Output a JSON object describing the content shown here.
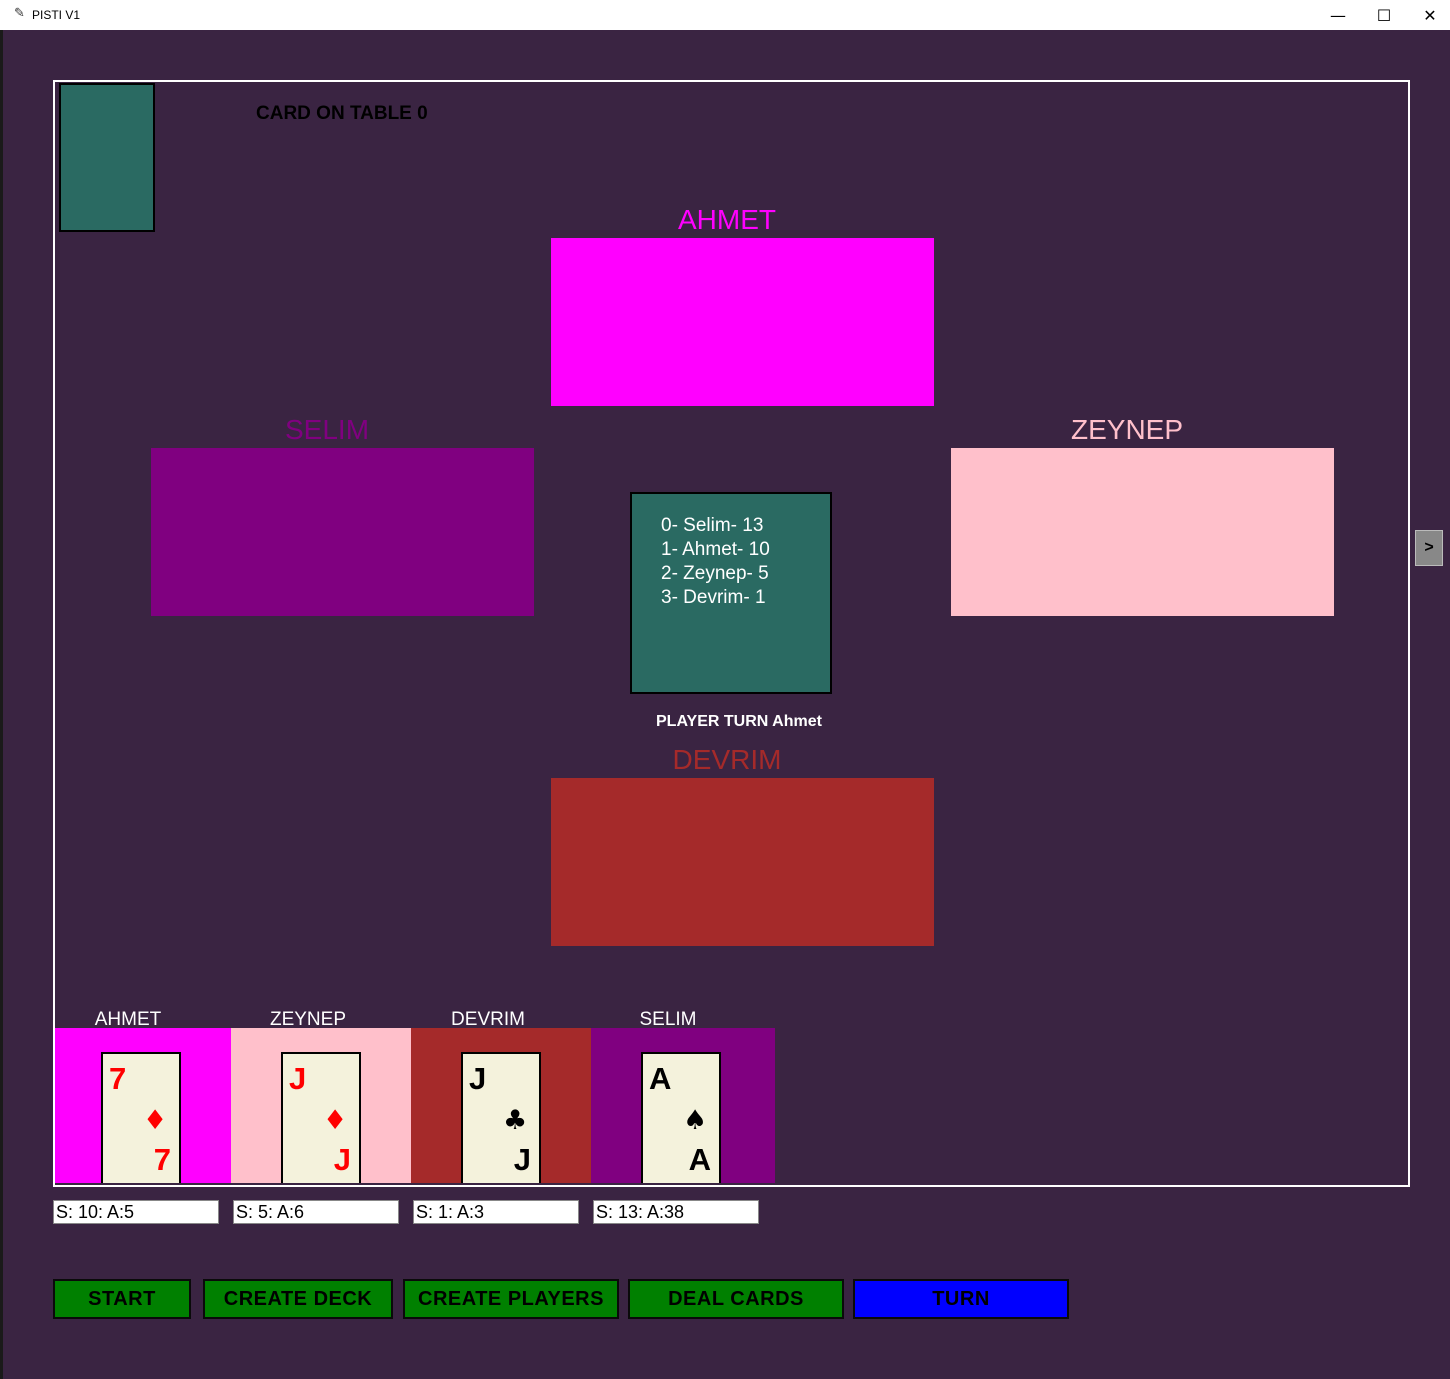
{
  "window": {
    "title": "PISTI V1",
    "icons": [
      "feather-icon",
      "minimize-icon",
      "maximize-icon",
      "close-icon"
    ],
    "controls": {
      "minimize": "—",
      "maximize": "☐",
      "close": "✕"
    }
  },
  "table": {
    "card_on_table_label": "CARD ON TABLE 0",
    "players": [
      {
        "name": "AHMET",
        "color": "#ff00ff"
      },
      {
        "name": "SELIM",
        "color": "#800080"
      },
      {
        "name": "ZEYNEP",
        "color": "#ffc0cb"
      },
      {
        "name": "DEVRIM",
        "color": "#a52a2a"
      }
    ],
    "scoreboard": [
      "0- Selim- 13",
      "1- Ahmet- 10",
      "2- Zeynep- 5",
      "3- Devrim- 1"
    ],
    "player_turn": "PLAYER TURN Ahmet",
    "scroll_button": ">"
  },
  "hands": [
    {
      "name": "AHMET",
      "bg": "#ff00ff",
      "card": {
        "rank": "7",
        "suit": "♦",
        "suit_color": "#ff0000"
      },
      "score": "S: 10: A:5"
    },
    {
      "name": "ZEYNEP",
      "bg": "#ffc0cb",
      "card": {
        "rank": "J",
        "suit": "♦",
        "suit_color": "#ff0000"
      },
      "score": "S: 5: A:6"
    },
    {
      "name": "DEVRIM",
      "bg": "#a52a2a",
      "card": {
        "rank": "J",
        "suit": "♣",
        "suit_color": "#000000"
      },
      "score": "S: 1: A:3"
    },
    {
      "name": "SELIM",
      "bg": "#800080",
      "card": {
        "rank": "A",
        "suit": "♠",
        "suit_color": "#000000"
      },
      "score": "S: 13: A:38"
    }
  ],
  "buttons": [
    {
      "label": "START",
      "color": "#008000"
    },
    {
      "label": "CREATE DECK",
      "color": "#008000"
    },
    {
      "label": "CREATE PLAYERS",
      "color": "#008000"
    },
    {
      "label": "DEAL CARDS",
      "color": "#008000"
    },
    {
      "label": "TURN",
      "color": "#0000ff"
    }
  ]
}
